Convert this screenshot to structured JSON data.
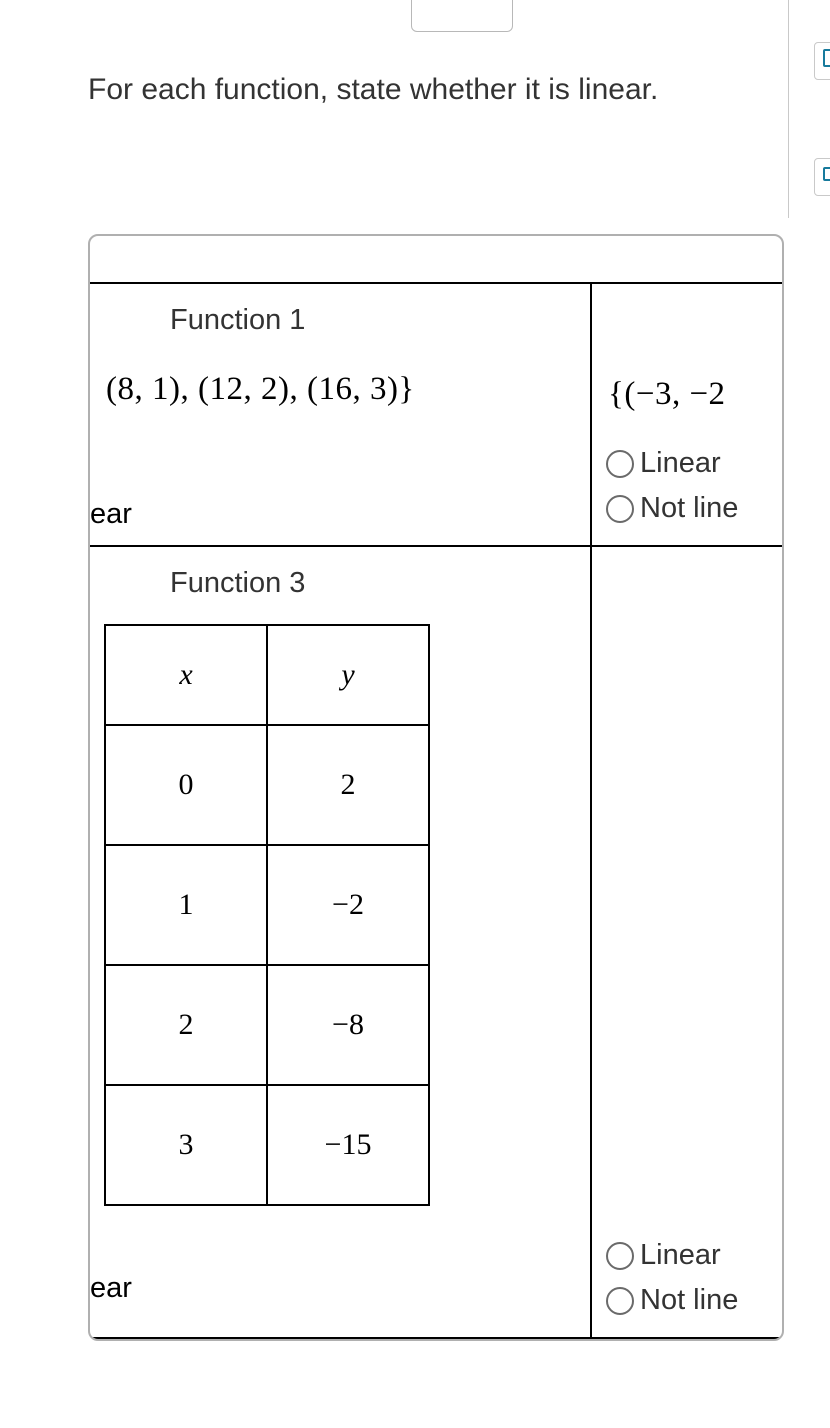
{
  "prompt": "For each function, state whether it is linear.",
  "functions": {
    "f1": {
      "label": "Function 1",
      "points_text": "(8, 1), (12, 2), (16, 3)}"
    },
    "f2": {
      "partial_points": "{(−3, −2",
      "options": {
        "linear": "Linear",
        "not_linear": "Not line"
      }
    },
    "f3": {
      "label": "Function 3",
      "table": {
        "headers": {
          "x": "x",
          "y": "y"
        },
        "rows": [
          {
            "x": "0",
            "y": "2"
          },
          {
            "x": "1",
            "y": "−2"
          },
          {
            "x": "2",
            "y": "−8"
          },
          {
            "x": "3",
            "y": "−15"
          }
        ]
      }
    },
    "f4": {
      "options": {
        "linear": "Linear",
        "not_linear": "Not line"
      }
    }
  },
  "left_partial_word": "ear",
  "left_partial_word_bottom": "ear"
}
